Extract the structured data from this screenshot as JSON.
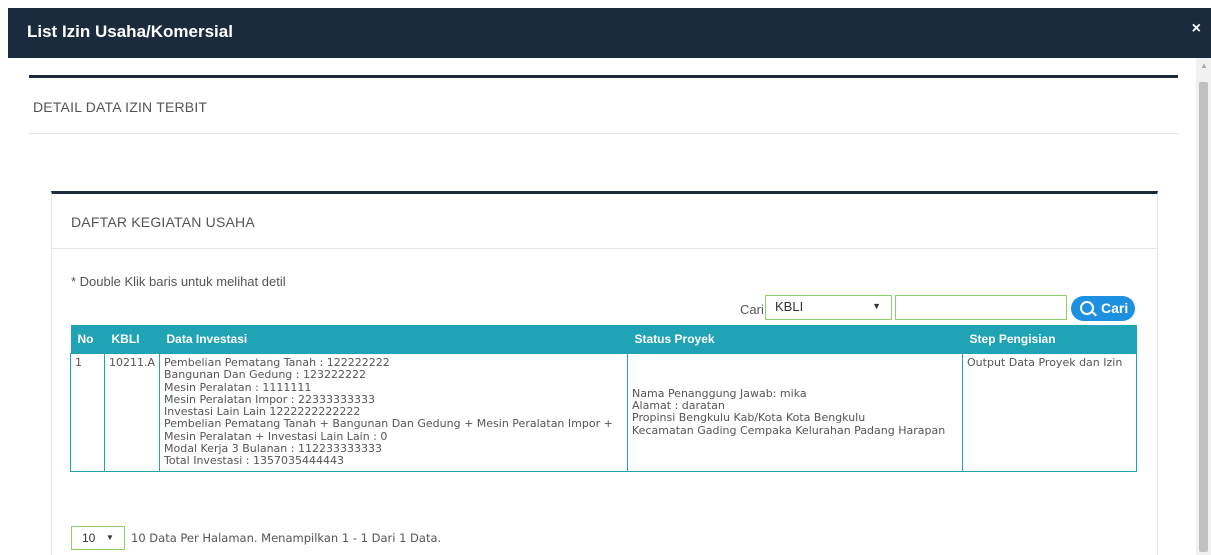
{
  "modal": {
    "title": "List Izin Usaha/Komersial",
    "close_label": "×"
  },
  "outer_panel": {
    "heading": "DETAIL DATA IZIN TERBIT"
  },
  "inner_panel": {
    "heading": "DAFTAR KEGIATAN USAHA",
    "hint": "* Double Klik baris untuk melihat detil"
  },
  "search": {
    "label": "Cari",
    "selected_field": "KBLI",
    "input_value": "",
    "button_label": "Cari"
  },
  "table": {
    "columns": [
      "No",
      "KBLI",
      "Data Investasi",
      "Status Proyek",
      "Step Pengisian"
    ],
    "rows": [
      {
        "no": "1",
        "kbli": "10211.A",
        "investasi": [
          "Pembelian Pematang Tanah : 122222222",
          "Bangunan Dan Gedung : 123222222",
          "Mesin Peralatan : 1111111",
          "Mesin Peralatan Impor : 22333333333",
          "Investasi Lain Lain 1222222222222",
          "Pembelian Pematang Tanah + Bangunan Dan Gedung + Mesin Peralatan Impor +",
          "Mesin Peralatan + Investasi Lain Lain : 0",
          "Modal Kerja 3 Bulanan : 112233333333",
          "Total Investasi : 1357035444443"
        ],
        "status": [
          "Nama Penanggung Jawab: mika",
          "Alamat : daratan",
          "Propinsi Bengkulu Kab/Kota Kota Bengkulu",
          "Kecamatan Gading Cempaka Kelurahan Padang Harapan"
        ],
        "step": "Output Data Proyek dan Izin"
      }
    ]
  },
  "pager": {
    "page_size": "10",
    "info": "10 Data Per Halaman. Menampilkan 1 - 1 Dari 1 Data."
  },
  "colors": {
    "header_bg": "#1b2a3d",
    "table_header_bg": "#1fa3b5",
    "button_bg": "#1e90e0",
    "input_border": "#8fce6a"
  }
}
